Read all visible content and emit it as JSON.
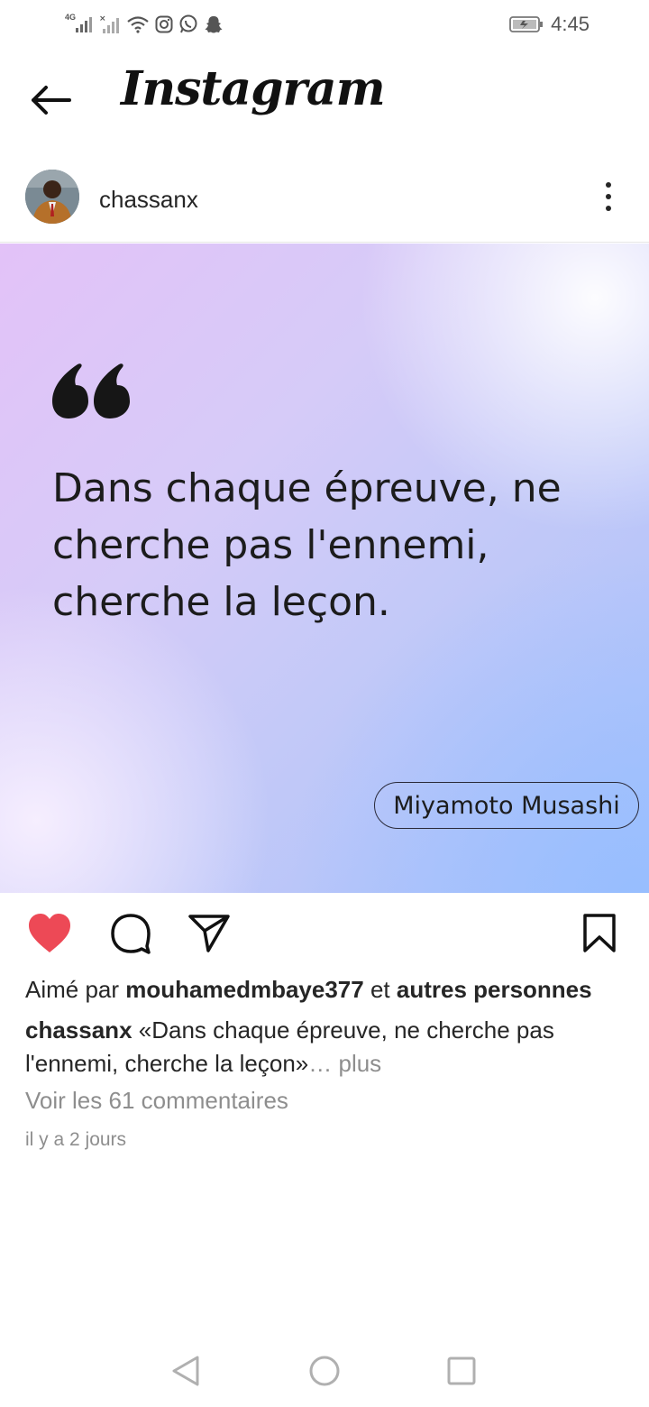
{
  "status_bar": {
    "network_label": "4G",
    "time": "4:45",
    "icons": [
      "signal-icon",
      "signal-no-sim-icon",
      "wifi-icon",
      "instagram-notification-icon",
      "whatsapp-notification-icon",
      "snapchat-notification-icon",
      "battery-charging-icon"
    ]
  },
  "header": {
    "back_icon": "arrow-left-icon",
    "logo_text": "Instagram"
  },
  "post": {
    "username": "chassanx",
    "avatar_icon": "user-avatar",
    "menu_icon": "more-vertical-icon",
    "image": {
      "quote_text": "Dans chaque épreuve, ne cherche pas l'ennemi, cherche la leçon.",
      "author": "Miyamoto Musashi",
      "colors": {
        "gradient_start": "#e3c2f8",
        "gradient_end": "#a8c0fb"
      }
    },
    "actions": {
      "like_icon": "heart-filled-icon",
      "like_color": "#ed4956",
      "comment_icon": "comment-icon",
      "share_icon": "send-icon",
      "save_icon": "bookmark-icon"
    },
    "likes": {
      "prefix": "Aimé par ",
      "user": "mouhamedmbaye377",
      "middle": " et ",
      "others": "autres personnes"
    },
    "caption": {
      "user": "chassanx",
      "text": " «Dans chaque épreuve, ne cherche pas l'ennemi, cherche la leçon»",
      "more": "… plus"
    },
    "comments_link": "Voir les 61 commentaires",
    "timestamp": "il y a 2 jours"
  },
  "nav_bar": {
    "back_icon": "triangle-back-icon",
    "home_icon": "circle-home-icon",
    "recents_icon": "square-recents-icon"
  }
}
